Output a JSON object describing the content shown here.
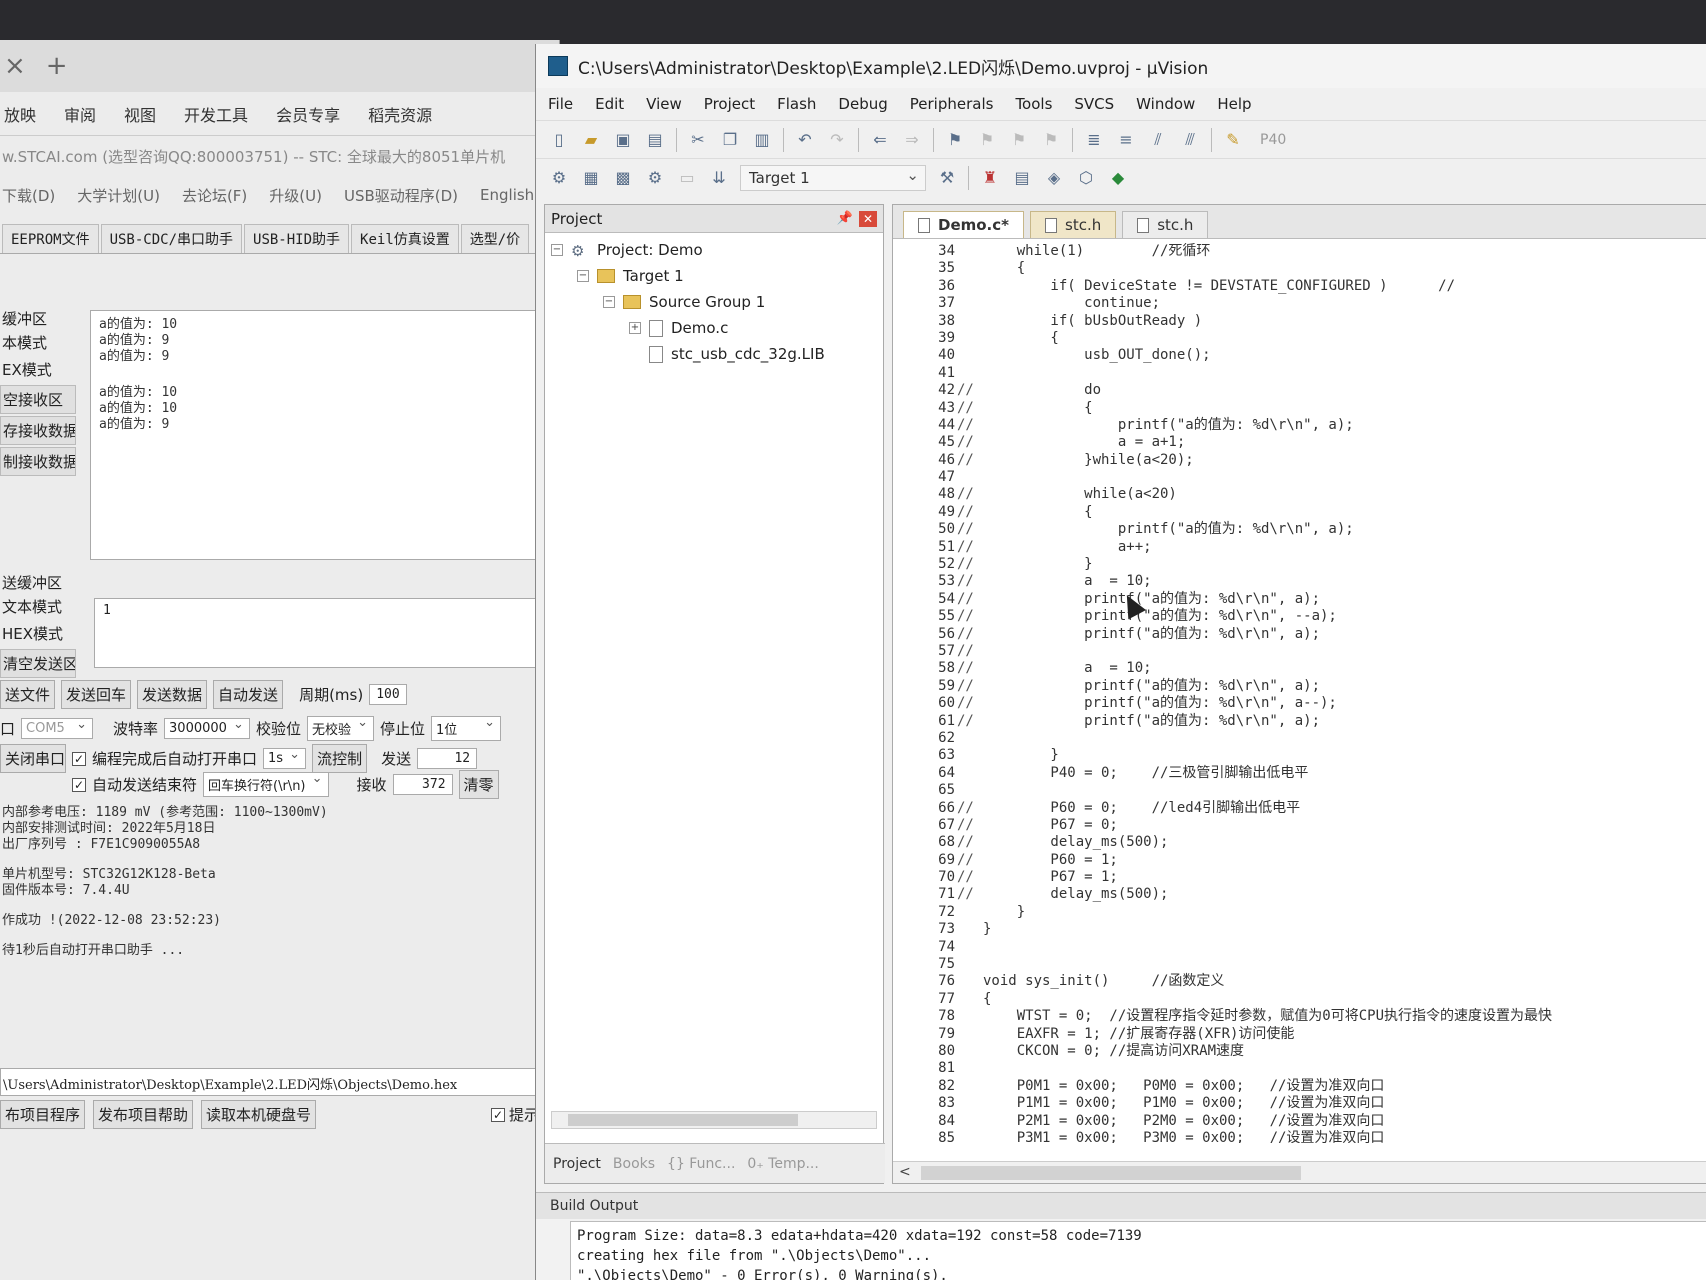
{
  "left_window": {
    "tab_close": "×",
    "tab_add": "+",
    "menu": [
      "放映",
      "审阅",
      "视图",
      "开发工具",
      "会员专享",
      "稻壳资源"
    ],
    "url_line": "w.STCAI.com  (选型咨询QQ:800003751) -- STC: 全球最大的8051单片机",
    "links": [
      "下载(D)",
      "大学计划(U)",
      "去论坛(F)",
      "升级(U)",
      "USB驱动程序(D)",
      "English"
    ],
    "tool_tabs": [
      "EEPROM文件",
      "USB-CDC/串口助手",
      "USB-HID助手",
      "Keil仿真设置",
      "选型/价"
    ],
    "recv_section": "缓冲区",
    "recv_opts": [
      "本模式",
      "EX模式"
    ],
    "recv_btns": [
      "空接收区",
      "存接收数据",
      "制接收数据"
    ],
    "recv_lines_a": [
      "a的值为: 10",
      "a的值为: 9",
      "a的值为: 9"
    ],
    "recv_lines_b": [
      "a的值为: 10",
      "a的值为: 10",
      "a的值为: 9"
    ],
    "send_section": "送缓冲区",
    "send_opts": [
      "文本模式",
      "HEX模式"
    ],
    "send_btn": "清空发送区",
    "send_text": "1",
    "send_buttons": [
      "送文件",
      "发送回车",
      "发送数据",
      "自动发送"
    ],
    "period_label": "周期(ms)",
    "period_value": "100",
    "port_label": "口",
    "port_value": "COM5",
    "baud_label": "波特率",
    "baud_value": "3000000",
    "parity_label": "校验位",
    "parity_value": "无校验",
    "stop_label": "停止位",
    "stop_value": "1位",
    "close_port": "关闭串口",
    "auto_open": "编程完成后自动打开串口",
    "auto_open_delay": "1s",
    "flow_ctrl": "流控制",
    "send_count_label": "发送",
    "send_count": "12",
    "auto_end": "自动发送结束符",
    "end_char": "回车换行符(\\r\\n)",
    "recv_count_label": "接收",
    "recv_count": "372",
    "clear_btn": "清零",
    "info_lines": [
      "内部参考电压: 1189 mV (参考范围: 1100~1300mV)",
      "内部安排测试时间: 2022年5月18日",
      "出厂序列号 : F7E1C9090055A8",
      "",
      "单片机型号: STC32G12K128-Beta",
      "固件版本号: 7.4.4U",
      "",
      "作成功 !(2022-12-08 23:52:23)",
      "",
      "待1秒后自动打开串口助手 ..."
    ],
    "hex_path": "\\Users\\Administrator\\Desktop\\Example\\2.LED闪烁\\Objects\\Demo.hex",
    "bottom_buttons": [
      "布项目程序",
      "发布项目帮助",
      "读取本机硬盘号"
    ],
    "hint_label": "提示音"
  },
  "uvision": {
    "title": "C:\\Users\\Administrator\\Desktop\\Example\\2.LED闪烁\\Demo.uvproj - µVision",
    "menu": [
      "File",
      "Edit",
      "View",
      "Project",
      "Flash",
      "Debug",
      "Peripherals",
      "Tools",
      "SVCS",
      "Window",
      "Help"
    ],
    "toolbar_symbol": "P40",
    "target": "Target 1",
    "project_panel": {
      "title": "Project",
      "root": "Project: Demo",
      "target": "Target 1",
      "group": "Source Group 1",
      "files": [
        "Demo.c",
        "stc_usb_cdc_32g.LIB"
      ],
      "tabs": [
        "Project",
        "Books",
        "{} Func...",
        "0₊ Temp..."
      ]
    },
    "editor_tabs": [
      "Demo.c*",
      "stc.h",
      "stc.h"
    ],
    "code": [
      {
        "n": "34",
        "c": "",
        "t": "    while(1)        //死循环"
      },
      {
        "n": "35",
        "c": "",
        "t": "    {"
      },
      {
        "n": "36",
        "c": "",
        "t": "        if( DeviceState != DEVSTATE_CONFIGURED )      //"
      },
      {
        "n": "37",
        "c": "",
        "t": "            continue;"
      },
      {
        "n": "38",
        "c": "",
        "t": "        if( bUsbOutReady )"
      },
      {
        "n": "39",
        "c": "",
        "t": "        {"
      },
      {
        "n": "40",
        "c": "",
        "t": "            usb_OUT_done();"
      },
      {
        "n": "41",
        "c": "",
        "t": ""
      },
      {
        "n": "42",
        "c": "//",
        "t": "            do"
      },
      {
        "n": "43",
        "c": "//",
        "t": "            {"
      },
      {
        "n": "44",
        "c": "//",
        "t": "                printf(\"a的值为: %d\\r\\n\", a);"
      },
      {
        "n": "45",
        "c": "//",
        "t": "                a = a+1;"
      },
      {
        "n": "46",
        "c": "//",
        "t": "            }while(a<20);"
      },
      {
        "n": "47",
        "c": "",
        "t": ""
      },
      {
        "n": "48",
        "c": "//",
        "t": "            while(a<20)"
      },
      {
        "n": "49",
        "c": "//",
        "t": "            {"
      },
      {
        "n": "50",
        "c": "//",
        "t": "                printf(\"a的值为: %d\\r\\n\", a);"
      },
      {
        "n": "51",
        "c": "//",
        "t": "                a++;"
      },
      {
        "n": "52",
        "c": "//",
        "t": "            }"
      },
      {
        "n": "53",
        "c": "//",
        "t": "            a  = 10;"
      },
      {
        "n": "54",
        "c": "//",
        "t": "            printf(\"a的值为: %d\\r\\n\", a);"
      },
      {
        "n": "55",
        "c": "//",
        "t": "            printf(\"a的值为: %d\\r\\n\", --a);"
      },
      {
        "n": "56",
        "c": "//",
        "t": "            printf(\"a的值为: %d\\r\\n\", a);"
      },
      {
        "n": "57",
        "c": "//",
        "t": ""
      },
      {
        "n": "58",
        "c": "//",
        "t": "            a  = 10;"
      },
      {
        "n": "59",
        "c": "//",
        "t": "            printf(\"a的值为: %d\\r\\n\", a);"
      },
      {
        "n": "60",
        "c": "//",
        "t": "            printf(\"a的值为: %d\\r\\n\", a--);"
      },
      {
        "n": "61",
        "c": "//",
        "t": "            printf(\"a的值为: %d\\r\\n\", a);"
      },
      {
        "n": "62",
        "c": "",
        "t": ""
      },
      {
        "n": "63",
        "c": "",
        "t": "        }"
      },
      {
        "n": "64",
        "c": "",
        "t": "        P40 = 0;    //三极管引脚输出低电平"
      },
      {
        "n": "65",
        "c": "",
        "t": ""
      },
      {
        "n": "66",
        "c": "//",
        "t": "        P60 = 0;    //led4引脚输出低电平"
      },
      {
        "n": "67",
        "c": "//",
        "t": "        P67 = 0;"
      },
      {
        "n": "68",
        "c": "//",
        "t": "        delay_ms(500);"
      },
      {
        "n": "69",
        "c": "//",
        "t": "        P60 = 1;"
      },
      {
        "n": "70",
        "c": "//",
        "t": "        P67 = 1;"
      },
      {
        "n": "71",
        "c": "//",
        "t": "        delay_ms(500);"
      },
      {
        "n": "72",
        "c": "",
        "t": "    }"
      },
      {
        "n": "73",
        "c": "",
        "t": "}"
      },
      {
        "n": "74",
        "c": "",
        "t": ""
      },
      {
        "n": "75",
        "c": "",
        "t": ""
      },
      {
        "n": "76",
        "c": "",
        "t": "void sys_init()     //函数定义"
      },
      {
        "n": "77",
        "c": "",
        "t": "{"
      },
      {
        "n": "78",
        "c": "",
        "t": "    WTST = 0;  //设置程序指令延时参数，赋值为0可将CPU执行指令的速度设置为最快"
      },
      {
        "n": "79",
        "c": "",
        "t": "    EAXFR = 1; //扩展寄存器(XFR)访问使能"
      },
      {
        "n": "80",
        "c": "",
        "t": "    CKCON = 0; //提高访问XRAM速度"
      },
      {
        "n": "81",
        "c": "",
        "t": ""
      },
      {
        "n": "82",
        "c": "",
        "t": "    P0M1 = 0x00;   P0M0 = 0x00;   //设置为准双向口"
      },
      {
        "n": "83",
        "c": "",
        "t": "    P1M1 = 0x00;   P1M0 = 0x00;   //设置为准双向口"
      },
      {
        "n": "84",
        "c": "",
        "t": "    P2M1 = 0x00;   P2M0 = 0x00;   //设置为准双向口"
      },
      {
        "n": "85",
        "c": "",
        "t": "    P3M1 = 0x00;   P3M0 = 0x00;   //设置为准双向口"
      }
    ],
    "build": {
      "title": "Build Output",
      "lines": [
        "Program Size: data=8.3 edata+hdata=420 xdata=192 const=58 code=7139",
        "creating hex file from \".\\Objects\\Demo\"...",
        "\".\\Objects\\Demo\" - 0 Error(s), 0 Warning(s)."
      ]
    }
  }
}
